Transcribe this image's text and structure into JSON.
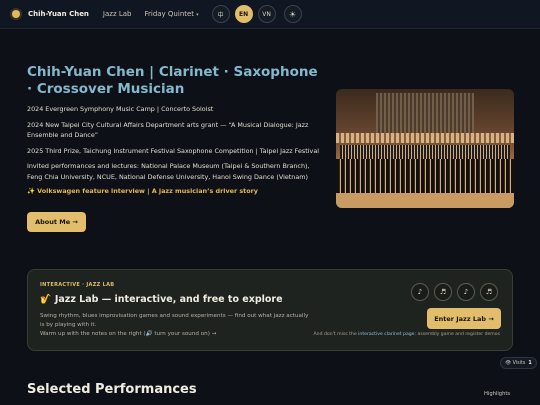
{
  "nav": {
    "brand": "Chih-Yuan Chen",
    "links": [
      "Jazz Lab",
      "Friday Quintet"
    ],
    "languages": [
      "中",
      "EN",
      "VN"
    ],
    "active_language": "EN",
    "theme_icon": "☀",
    "caret": "▾"
  },
  "hero": {
    "title": "Chih-Yuan Chen | Clarinet · Saxophone · Crossover Musician",
    "items": [
      "2024 Evergreen Symphony Music Camp | Concerto Soloist",
      "2024 New Taipei City Cultural Affairs Department arts grant — “A Musical Dialogue: Jazz Ensemble and Dance”",
      "2025 Third Prize, Taichung Instrument Festival Saxophone Competition | Taipei Jazz Festival",
      "Invited performances and lectures: National Palace Museum (Taipei & Southern Branch), Feng Chia University, NCUE, National Defense University, Hanoi Swing Dance (Vietnam)"
    ],
    "feature_link": "✨ Volkswagen feature interview | A jazz musician’s driver story",
    "about_button": "About Me →"
  },
  "jazz_lab": {
    "eyebrow": "INTERACTIVE · JAZZ LAB",
    "sax_icon": "🎷",
    "title": "Jazz Lab — interactive, and free to explore",
    "description_line1": "Swing rhythm, blues improvisation games and sound experiments — find out what jazz actually is by playing with it.",
    "description_line2": "Warm up with the notes on the right (🔊 turn your sound on) →",
    "notes": [
      "♪",
      "♬",
      "♪",
      "♬"
    ],
    "enter_button": "Enter Jazz Lab →",
    "footer_prefix": "And don't miss the ",
    "footer_link": "interactive clarinet page",
    "footer_suffix": ": assembly game and register demos"
  },
  "visits": {
    "label": "👁 Visits",
    "count": "1"
  },
  "sections": {
    "performances_title": "Selected Performances",
    "highlights_label": "Highlights"
  },
  "colors": {
    "accent": "#e2bd6c",
    "title_blue": "#84b8cf",
    "background": "#0d1117"
  }
}
